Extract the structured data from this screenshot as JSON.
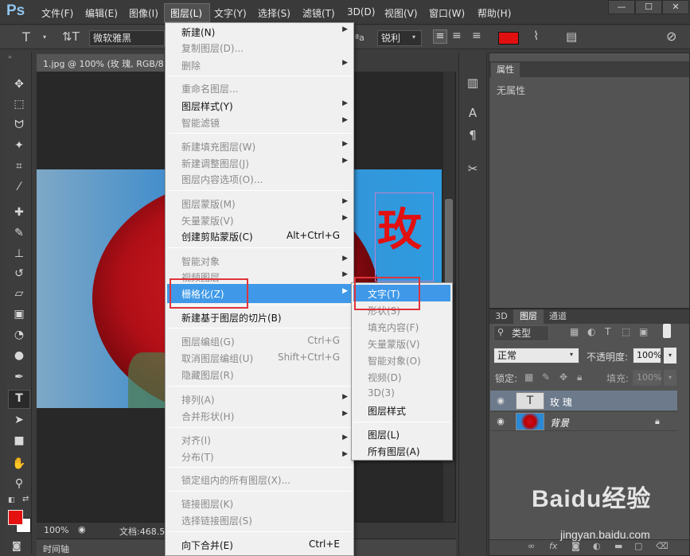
{
  "app": {
    "logo": "Ps"
  },
  "menubar": {
    "items": [
      "文件(F)",
      "编辑(E)",
      "图像(I)",
      "图层(L)",
      "文字(Y)",
      "选择(S)",
      "滤镜(T)",
      "3D(D)",
      "视图(V)",
      "窗口(W)",
      "帮助(H)"
    ],
    "window_buttons": [
      "—",
      "☐",
      "✕"
    ]
  },
  "options_bar": {
    "font_family": "微软雅黑",
    "aa_label": "ªa",
    "aa_mode": "锐利",
    "text_color": "#e01010"
  },
  "document": {
    "tab_title": "1.jpg @ 100% (玫 瑰, RGB/8",
    "canvas_text": "玫",
    "zoom": "100%",
    "doc_info": "文档:468.5",
    "timeline_label": "时间轴"
  },
  "properties_panel": {
    "tab": "属性",
    "empty_text": "无属性"
  },
  "layers_panel": {
    "tabs": [
      "3D",
      "图层",
      "通道"
    ],
    "filter_label": "类型",
    "blend_mode": "正常",
    "opacity_label": "不透明度:",
    "opacity_value": "100%",
    "lock_label": "锁定:",
    "fill_label": "填充:",
    "fill_value": "100%",
    "layers": [
      {
        "name": "玫 瑰",
        "thumb": "T"
      },
      {
        "name": "背景"
      }
    ]
  },
  "layer_menu": {
    "items": [
      {
        "label": "新建(N)",
        "arrow": true,
        "disabled": false
      },
      {
        "label": "复制图层(D)...",
        "disabled": true
      },
      {
        "label": "删除",
        "arrow": true,
        "disabled": true
      },
      {
        "label": "重命名图层...",
        "disabled": true
      },
      {
        "label": "图层样式(Y)",
        "arrow": true,
        "disabled": false
      },
      {
        "label": "智能滤镜",
        "arrow": true,
        "disabled": true
      },
      {
        "label": "新建填充图层(W)",
        "arrow": true,
        "disabled": true
      },
      {
        "label": "新建调整图层(J)",
        "arrow": true,
        "disabled": true
      },
      {
        "label": "图层内容选项(O)...",
        "disabled": true
      },
      {
        "label": "图层蒙版(M)",
        "arrow": true,
        "disabled": true
      },
      {
        "label": "矢量蒙版(V)",
        "arrow": true,
        "disabled": true
      },
      {
        "label": "创建剪贴蒙版(C)",
        "shortcut": "Alt+Ctrl+G",
        "disabled": false
      },
      {
        "label": "智能对象",
        "arrow": true,
        "disabled": true
      },
      {
        "label": "视频图层",
        "arrow": true,
        "disabled": true
      },
      {
        "label": "栅格化(Z)",
        "arrow": true,
        "disabled": false
      },
      {
        "label": "新建基于图层的切片(B)",
        "disabled": false
      },
      {
        "label": "图层编组(G)",
        "shortcut": "Ctrl+G",
        "disabled": true
      },
      {
        "label": "取消图层编组(U)",
        "shortcut": "Shift+Ctrl+G",
        "disabled": true
      },
      {
        "label": "隐藏图层(R)",
        "disabled": true
      },
      {
        "label": "排列(A)",
        "arrow": true,
        "disabled": true
      },
      {
        "label": "合并形状(H)",
        "arrow": true,
        "disabled": true
      },
      {
        "label": "对齐(I)",
        "arrow": true,
        "disabled": true
      },
      {
        "label": "分布(T)",
        "arrow": true,
        "disabled": true
      },
      {
        "label": "锁定组内的所有图层(X)...",
        "disabled": true
      },
      {
        "label": "链接图层(K)",
        "disabled": true
      },
      {
        "label": "选择链接图层(S)",
        "disabled": true
      },
      {
        "label": "向下合并(E)",
        "shortcut": "Ctrl+E",
        "disabled": false
      }
    ]
  },
  "rasterize_submenu": {
    "items": [
      {
        "label": "文字(T)",
        "disabled": false
      },
      {
        "label": "形状(S)",
        "disabled": true
      },
      {
        "label": "填充内容(F)",
        "disabled": true
      },
      {
        "label": "矢量蒙版(V)",
        "disabled": true
      },
      {
        "label": "智能对象(O)",
        "disabled": true
      },
      {
        "label": "视频(D)",
        "disabled": true
      },
      {
        "label": "3D(3)",
        "disabled": true
      },
      {
        "label": "图层样式",
        "disabled": false
      },
      {
        "label": "图层(L)",
        "disabled": false
      },
      {
        "label": "所有图层(A)",
        "disabled": false
      }
    ]
  },
  "watermark": {
    "logo": "Baidu经验",
    "url": "jingyan.baidu.com"
  }
}
